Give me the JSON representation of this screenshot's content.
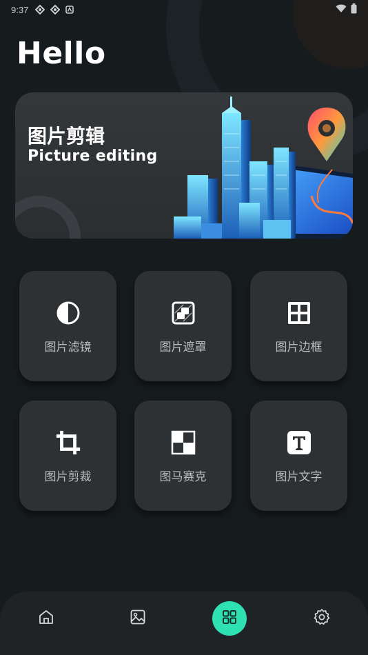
{
  "status_bar": {
    "time": "9:37",
    "icons": [
      "vpn-icon",
      "vpn-icon",
      "app-notification-icon",
      "wifi-icon",
      "battery-icon"
    ]
  },
  "greeting": "Hello",
  "banner": {
    "title": "图片剪辑",
    "subtitle": "Picture editing",
    "illustration": "city-map-pin-illustration"
  },
  "tools": [
    {
      "label": "图片滤镜",
      "icon": "filter-icon"
    },
    {
      "label": "图片遮罩",
      "icon": "mask-icon"
    },
    {
      "label": "图片边框",
      "icon": "frame-icon"
    },
    {
      "label": "图片剪裁",
      "icon": "crop-icon"
    },
    {
      "label": "图马赛克",
      "icon": "mosaic-icon"
    },
    {
      "label": "图片文字",
      "icon": "text-icon"
    }
  ],
  "bottom_nav": [
    {
      "icon": "home-icon",
      "active": false
    },
    {
      "icon": "image-icon",
      "active": false
    },
    {
      "icon": "apps-grid-icon",
      "active": true
    },
    {
      "icon": "settings-icon",
      "active": false
    }
  ],
  "colors": {
    "background": "#161b1e",
    "card": "#2e3134",
    "accent": "#2fe0b2",
    "label": "#b9bcbf"
  }
}
